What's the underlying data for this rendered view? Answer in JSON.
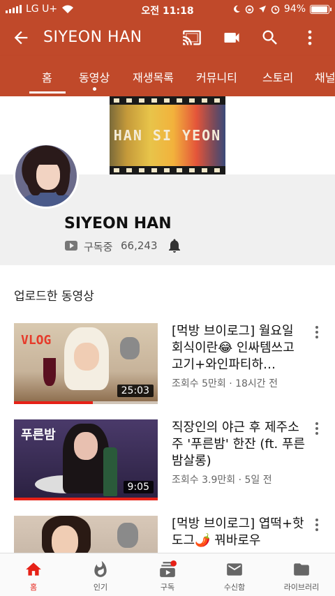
{
  "status_bar": {
    "carrier": "LG U+",
    "time": "오전 11:18",
    "battery": "94%",
    "battery_level": 0.94
  },
  "app_bar": {
    "title": "SIYEON HAN",
    "icons": [
      "back-arrow-icon",
      "cast-icon",
      "camera-icon",
      "search-icon",
      "more-vert-icon"
    ]
  },
  "tabs": [
    {
      "label": "홈",
      "active": true
    },
    {
      "label": "동영상",
      "active": false
    },
    {
      "label": "재생목록",
      "active": false
    },
    {
      "label": "커뮤니티",
      "active": false
    },
    {
      "label": "스토리",
      "active": false
    },
    {
      "label": "채널",
      "active": false
    }
  ],
  "banner": {
    "text": "HAN SI YEON"
  },
  "channel": {
    "name": "SIYEON HAN",
    "subscribed_label": "구독중",
    "subscriber_count": "66,243"
  },
  "section": {
    "title": "업로드한 동영상"
  },
  "videos": [
    {
      "title": "[먹방 브이로그] 월요일 회식이란😂 인싸템쓰고 고기+와인파티하…",
      "meta": "조회수 5만회 · 18시간 전",
      "duration": "25:03",
      "thumb_text": "VLOG",
      "watched": 0.55
    },
    {
      "title": "직장인의 야근 후 제주소주 '푸른밤' 한잔 (ft. 푸른밤살롱)",
      "meta": "조회수 3.9만회 · 5일 전",
      "duration": "9:05",
      "thumb_text": "푸른밤",
      "watched": 1.0
    },
    {
      "title": "[먹방 브이로그] 엽떡+핫도그🌶️ 꿔바로우",
      "meta": "",
      "duration": "",
      "thumb_text": "",
      "watched": 0
    }
  ],
  "bottom_nav": [
    {
      "label": "홈",
      "icon": "home-icon",
      "active": true
    },
    {
      "label": "인기",
      "icon": "trending-icon",
      "active": false
    },
    {
      "label": "구독",
      "icon": "subscriptions-icon",
      "active": false
    },
    {
      "label": "수신함",
      "icon": "inbox-icon",
      "active": false
    },
    {
      "label": "라이브러리",
      "icon": "library-icon",
      "active": false
    }
  ],
  "colors": {
    "brand": "#c0492a",
    "accent_red": "#e62117",
    "header_bg": "#f0f0f0"
  }
}
